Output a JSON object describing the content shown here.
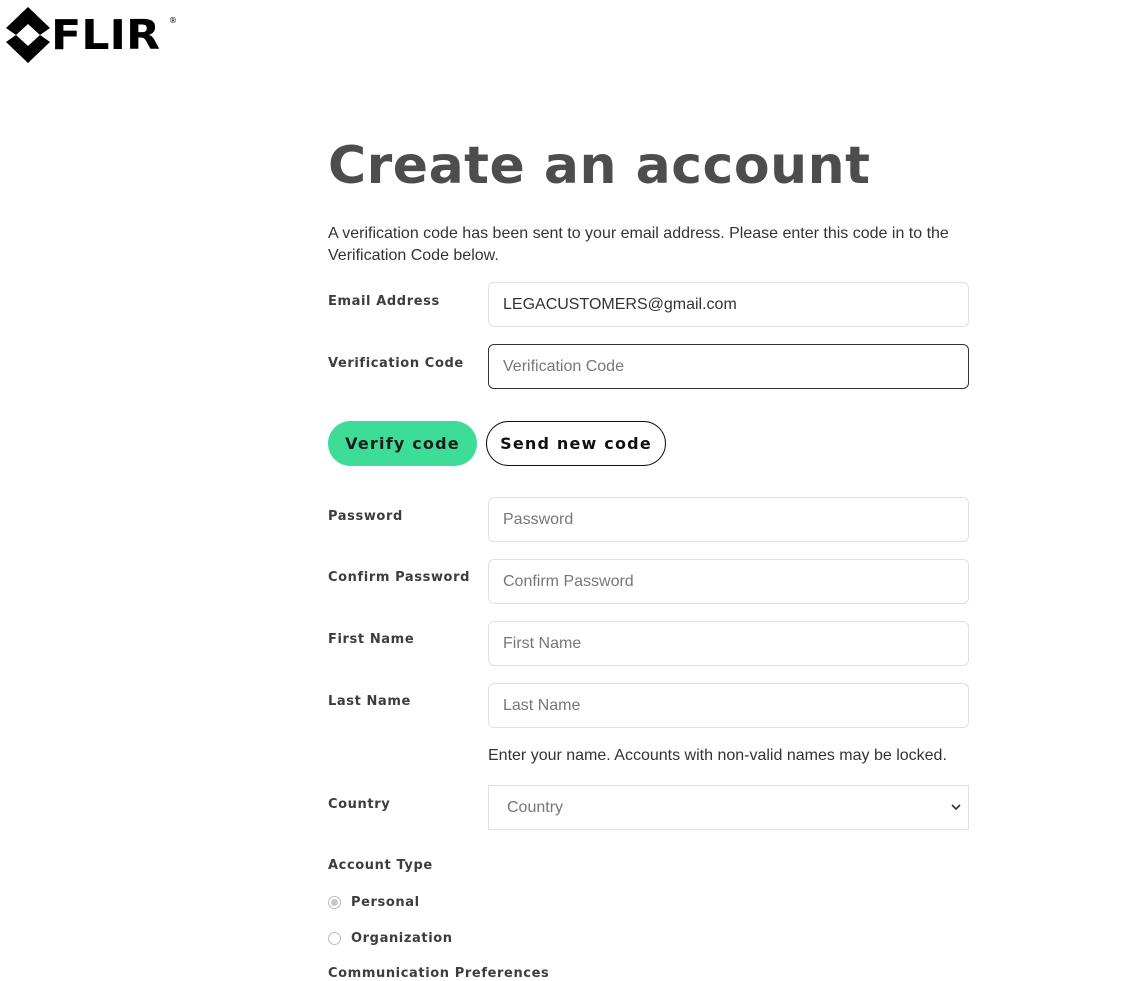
{
  "brand": {
    "name": "FLIR",
    "reg_mark": "®"
  },
  "page": {
    "title": "Create an account",
    "intro": "A verification code has been sent to your email address. Please enter this code in to the Verification Code below."
  },
  "form": {
    "email": {
      "label": "Email Address",
      "value": "LEGACUSTOMERS@gmail.com"
    },
    "verification_code": {
      "label": "Verification Code",
      "placeholder": "Verification Code",
      "value": ""
    },
    "buttons": {
      "verify_label": "Verify code",
      "send_new_label": "Send new code"
    },
    "password": {
      "label": "Password",
      "placeholder": "Password"
    },
    "confirm_password": {
      "label": "Confirm Password",
      "placeholder": "Confirm Password"
    },
    "first_name": {
      "label": "First Name",
      "placeholder": "First Name"
    },
    "last_name": {
      "label": "Last Name",
      "placeholder": "Last Name"
    },
    "name_hint": "Enter your name. Accounts with non-valid names may be locked.",
    "country": {
      "label": "Country",
      "selected": "Country"
    },
    "account_type": {
      "label": "Account Type",
      "options": [
        {
          "label": "Personal",
          "checked": true
        },
        {
          "label": "Organization",
          "checked": false
        }
      ]
    },
    "communication_preferences_label": "Communication Preferences"
  },
  "colors": {
    "accent": "#3ddc97",
    "title": "#4d4d4d",
    "border": "#e0e0e0",
    "focus_border": "#333333"
  },
  "icons": {
    "logo": "flir-diamond-icon",
    "select": "chevron-down-icon"
  }
}
